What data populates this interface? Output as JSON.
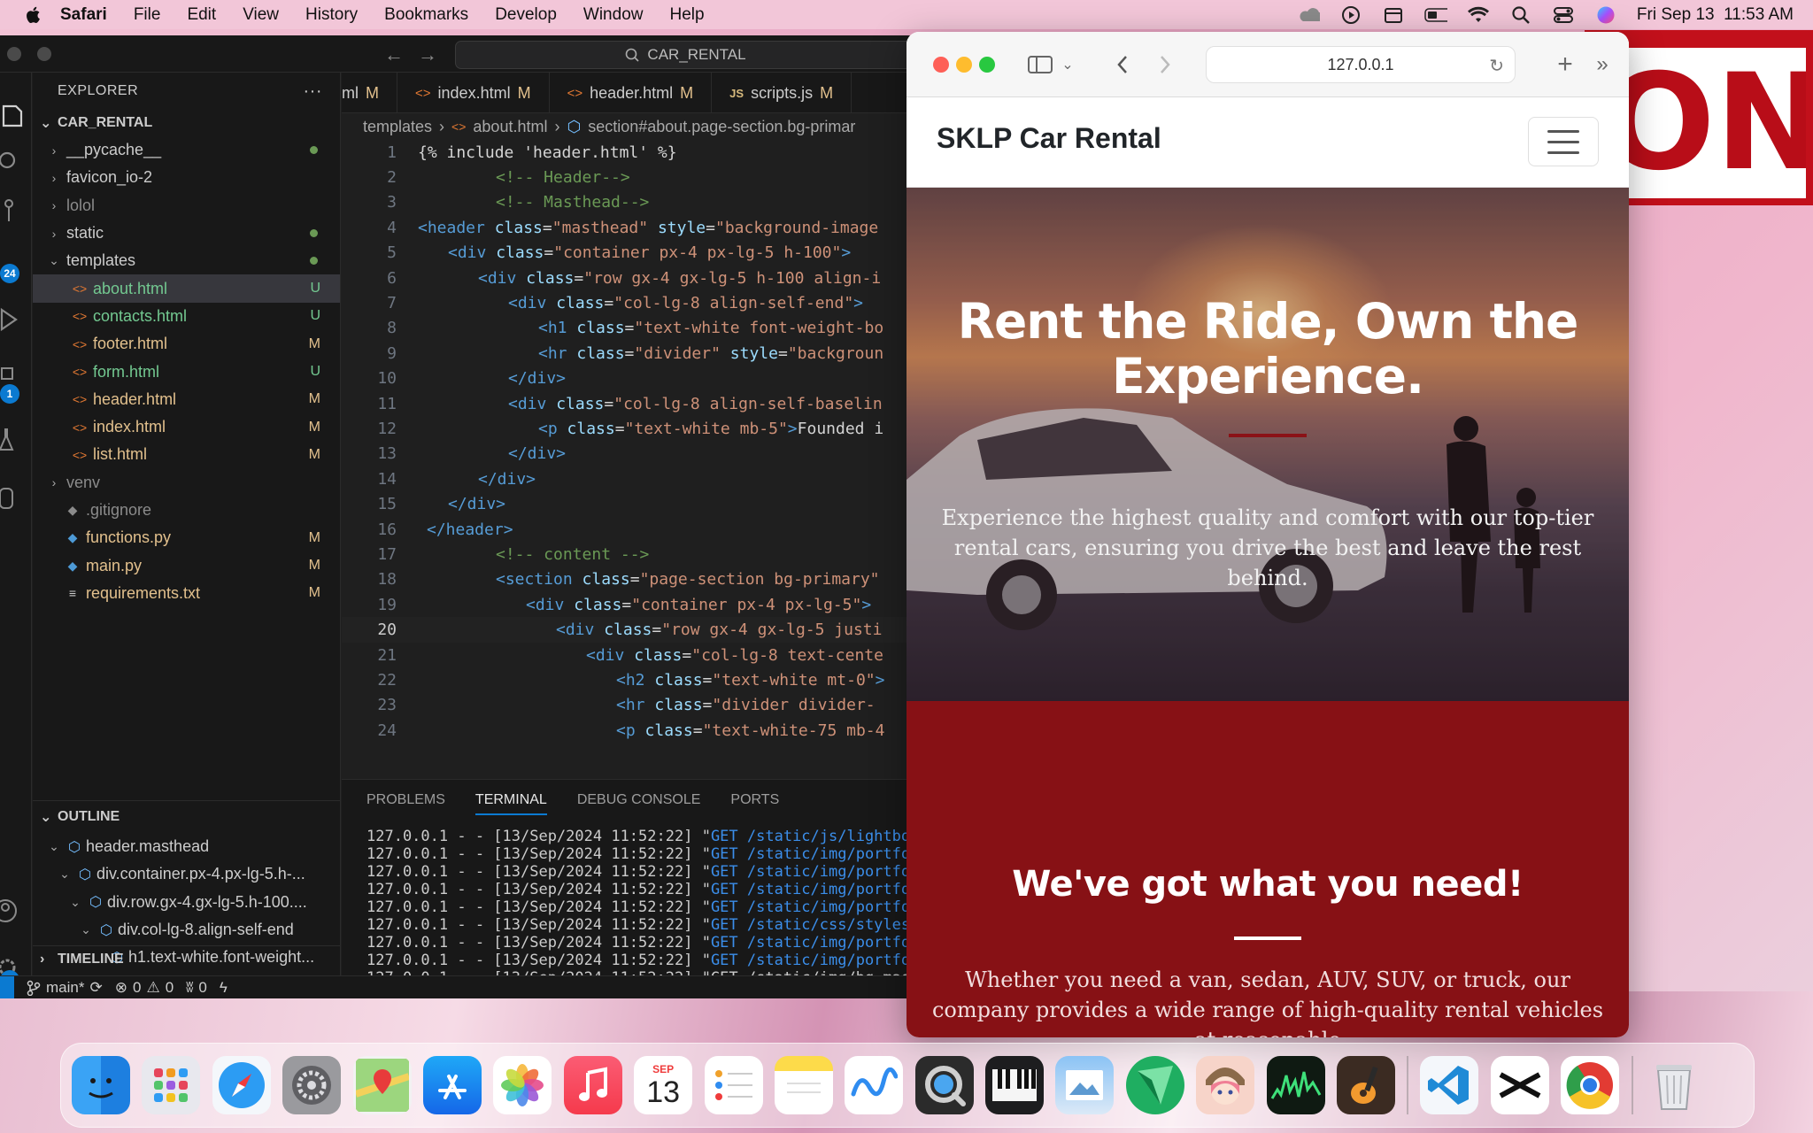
{
  "menubar": {
    "app_name": "Safari",
    "items": [
      "File",
      "Edit",
      "View",
      "History",
      "Bookmarks",
      "Develop",
      "Window",
      "Help"
    ],
    "datetime": "Fri Sep 13  11:53 AM"
  },
  "wallpaper": {
    "banner_text": "ON"
  },
  "vscode": {
    "search_text": "CAR_RENTAL",
    "explorer_title": "EXPLORER",
    "project_name": "CAR_RENTAL",
    "activity_badges": [
      "24",
      "1",
      "1"
    ],
    "files": [
      {
        "name": "__pycache__",
        "type": "folder",
        "status": "dot",
        "indent": 1
      },
      {
        "name": "favicon_io-2",
        "type": "folder",
        "status": "",
        "indent": 1
      },
      {
        "name": "lolol",
        "type": "folder",
        "status": "",
        "indent": 1
      },
      {
        "name": "static",
        "type": "folder",
        "status": "dot",
        "indent": 1
      },
      {
        "name": "templates",
        "type": "folder-open",
        "status": "dot",
        "indent": 1
      },
      {
        "name": "about.html",
        "type": "html",
        "status": "U",
        "indent": 2,
        "selected": true
      },
      {
        "name": "contacts.html",
        "type": "html",
        "status": "U",
        "indent": 2
      },
      {
        "name": "footer.html",
        "type": "html",
        "status": "M",
        "indent": 2
      },
      {
        "name": "form.html",
        "type": "html",
        "status": "U",
        "indent": 2
      },
      {
        "name": "header.html",
        "type": "html",
        "status": "M",
        "indent": 2
      },
      {
        "name": "index.html",
        "type": "html",
        "status": "M",
        "indent": 2
      },
      {
        "name": "list.html",
        "type": "html",
        "status": "M",
        "indent": 2
      },
      {
        "name": "venv",
        "type": "folder",
        "status": "",
        "indent": 1
      },
      {
        "name": ".gitignore",
        "type": "git",
        "status": "",
        "indent": 1
      },
      {
        "name": "functions.py",
        "type": "py",
        "status": "M",
        "indent": 1
      },
      {
        "name": "main.py",
        "type": "py",
        "status": "M",
        "indent": 1
      },
      {
        "name": "requirements.txt",
        "type": "txt",
        "status": "M",
        "indent": 1
      }
    ],
    "outline_title": "OUTLINE",
    "outline": [
      "header.masthead",
      "div.container.px-4.px-lg-5.h-...",
      "div.row.gx-4.gx-lg-5.h-100....",
      "div.col-lg-8.align-self-end",
      "h1.text-white.font-weight...",
      "hr.divider"
    ],
    "timeline_title": "TIMELINE",
    "tabs": [
      {
        "label": "ml",
        "status": "M"
      },
      {
        "label": "index.html",
        "status": "M"
      },
      {
        "label": "header.html",
        "status": "M"
      },
      {
        "label": "scripts.js",
        "status": "M"
      }
    ],
    "breadcrumb": [
      "templates",
      "about.html",
      "section#about.page-section.bg-primar"
    ],
    "current_line": 20,
    "panel_tabs": [
      "PROBLEMS",
      "TERMINAL",
      "DEBUG CONSOLE",
      "PORTS"
    ],
    "active_panel_tab": "TERMINAL",
    "terminal": [
      {
        "prefix": "127.0.0.1 - - [13/Sep/2024 11:52:22] \"",
        "method": "GET",
        "path": " /static/js/lightbox"
      },
      {
        "prefix": "127.0.0.1 - - [13/Sep/2024 11:52:22] \"",
        "method": "GET",
        "path": " /static/img/portfol"
      },
      {
        "prefix": "127.0.0.1 - - [13/Sep/2024 11:52:22] \"",
        "method": "GET",
        "path": " /static/img/portfol"
      },
      {
        "prefix": "127.0.0.1 - - [13/Sep/2024 11:52:22] \"",
        "method": "GET",
        "path": " /static/img/portfol"
      },
      {
        "prefix": "127.0.0.1 - - [13/Sep/2024 11:52:22] \"",
        "method": "GET",
        "path": " /static/img/portfol"
      },
      {
        "prefix": "127.0.0.1 - - [13/Sep/2024 11:52:22] \"",
        "method": "GET",
        "path": " /static/css/styles."
      },
      {
        "prefix": "127.0.0.1 - - [13/Sep/2024 11:52:22] \"",
        "method": "GET",
        "path": " /static/img/portfol"
      },
      {
        "prefix": "127.0.0.1 - - [13/Sep/2024 11:52:22] \"",
        "method": "GET",
        "path": " /static/img/portfol"
      },
      {
        "prefix": "127.0.0.1 - - [13/Sep/2024 11:52:22] \"",
        "method": "GET",
        "path": " /static/img/bg-mast"
      }
    ],
    "status": {
      "branch": "main*",
      "errors": "0",
      "warnings": "0",
      "ports": "0"
    }
  },
  "safari": {
    "url": "127.0.0.1",
    "site": {
      "brand": "SKLP Car Rental",
      "hero_title": "Rent the Ride, Own the Experience.",
      "hero_text": "Experience the highest quality and comfort with our top-tier rental cars, ensuring you drive the best and leave the rest behind.",
      "about_title": "We've got what you need!",
      "about_text": "Whether you need a van, sedan, AUV, SUV, or truck, our company provides a wide range of high-quality rental vehicles at reasonable"
    }
  },
  "dock": {
    "calendar_month": "SEP",
    "calendar_day": "13"
  }
}
